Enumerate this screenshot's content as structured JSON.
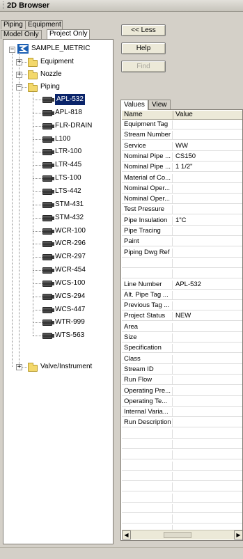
{
  "window": {
    "title": "2D Browser"
  },
  "left_tabs": {
    "row1": [
      "Piping",
      "Equipment"
    ],
    "row2": [
      "Model Only",
      "Project Only"
    ],
    "active": "Project Only"
  },
  "tree": {
    "root": "SAMPLE_METRIC",
    "groups": [
      {
        "label": "Equipment",
        "expanded": false
      },
      {
        "label": "Nozzle",
        "expanded": false
      },
      {
        "label": "Piping",
        "expanded": true
      },
      {
        "label": "Valve/Instrument",
        "expanded": false
      }
    ],
    "piping_items": [
      "APL-532",
      "APL-818",
      "FLR-DRAIN",
      "L100",
      "LTR-100",
      "LTR-445",
      "LTS-100",
      "LTS-442",
      "STM-431",
      "STM-432",
      "WCR-100",
      "WCR-296",
      "WCR-297",
      "WCR-454",
      "WCS-100",
      "WCS-294",
      "WCS-447",
      "WTR-999",
      "WTS-563"
    ],
    "selected": "APL-532"
  },
  "buttons": {
    "less": "<< Less",
    "help": "Help",
    "find": "Find"
  },
  "right_tabs": [
    "Values",
    "View"
  ],
  "grid": {
    "headers": [
      "Name",
      "Value"
    ],
    "rows": [
      [
        "Equipment Tag",
        ""
      ],
      [
        "Stream Number",
        ""
      ],
      [
        "Service",
        "WW"
      ],
      [
        "Nominal Pipe ...",
        "CS150"
      ],
      [
        "Nominal Pipe ...",
        "1 1/2\""
      ],
      [
        "Material of Co...",
        ""
      ],
      [
        "Nominal Oper...",
        ""
      ],
      [
        "Nominal Oper...",
        ""
      ],
      [
        "Test Pressure",
        ""
      ],
      [
        "Pipe Insulation",
        "1\"C"
      ],
      [
        "Pipe Tracing",
        ""
      ],
      [
        "Paint",
        ""
      ],
      [
        "Piping Dwg Ref",
        ""
      ],
      [
        "",
        ""
      ],
      [
        "",
        ""
      ],
      [
        "Line Number",
        "APL-532"
      ],
      [
        "Alt. Pipe Tag ...",
        ""
      ],
      [
        "Previous Tag ...",
        ""
      ],
      [
        "Project Status",
        "NEW"
      ],
      [
        "Area",
        ""
      ],
      [
        "Size",
        ""
      ],
      [
        "Specification",
        ""
      ],
      [
        "Class",
        ""
      ],
      [
        "Stream ID",
        ""
      ],
      [
        "Run Flow",
        ""
      ],
      [
        "Operating Pre...",
        ""
      ],
      [
        "Operating Te...",
        ""
      ],
      [
        "Internal Varia...",
        ""
      ],
      [
        "Run Description",
        ""
      ]
    ]
  }
}
